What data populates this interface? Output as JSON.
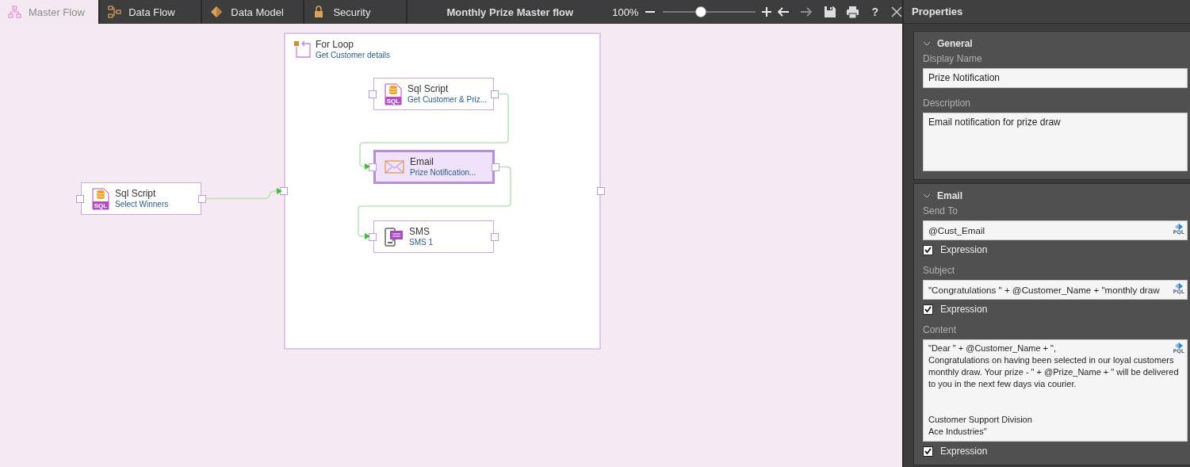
{
  "tabs": [
    {
      "label": "Master Flow",
      "selected": true
    },
    {
      "label": "Data Flow",
      "selected": false
    },
    {
      "label": "Data Model",
      "selected": false
    },
    {
      "label": "Security",
      "selected": false
    }
  ],
  "toolbar": {
    "title": "Monthly Prize Master flow",
    "zoom": "100%",
    "zoom_slider": {
      "level": 0.41
    },
    "buttons": [
      {
        "kind": "undo",
        "disabled": false
      },
      {
        "kind": "redo",
        "disabled": true
      },
      {
        "kind": "save",
        "disabled": false
      },
      {
        "kind": "print",
        "disabled": false
      },
      {
        "kind": "help",
        "label": "?",
        "disabled": false
      },
      {
        "kind": "close",
        "disabled": false
      }
    ]
  },
  "canvas": {
    "nodes": [
      {
        "kind": "sql",
        "icon_label": "SQL",
        "title": "Sql Script",
        "subtitle": "Select Winners",
        "selected": false
      },
      {
        "kind": "loop",
        "title": "For Loop",
        "subtitle": "Get Customer details",
        "selected": false,
        "children": [
          {
            "kind": "sql",
            "icon_label": "SQL",
            "title": "Sql Script",
            "subtitle": "Get Customer & Priz...",
            "selected": false
          },
          {
            "kind": "email",
            "title": "Email",
            "subtitle": "Prize Notification...",
            "selected": true
          },
          {
            "kind": "sms",
            "title": "SMS",
            "subtitle": "SMS 1",
            "selected": false
          }
        ]
      }
    ]
  },
  "properties": {
    "title": "Properties",
    "sections": [
      {
        "title": "General",
        "expanded": true,
        "fields": [
          {
            "kind": "text",
            "label": "Display Name",
            "value": "Prize Notification"
          },
          {
            "kind": "multiline",
            "label": "Description",
            "value": "Email notification for prize draw"
          }
        ]
      },
      {
        "title": "Email",
        "expanded": true,
        "fields": [
          {
            "kind": "expression",
            "label": "Send To",
            "value": "@Cust_Email",
            "badge": "PQL",
            "expression": {
              "label": "Expression",
              "checked": true
            }
          },
          {
            "kind": "expression",
            "label": "Subject",
            "value": "\"Congratulations \" + @Customer_Name + \"monthly draw",
            "badge": "PQL",
            "expression": {
              "label": "Expression",
              "checked": true
            }
          },
          {
            "kind": "expression_multiline",
            "label": "Content",
            "value": "\"Dear \" + @Customer_Name + \",\nCongratulations on having been selected in our loyal customers monthly draw. Your prize - \" + @Prize_Name + \" will be delivered to you in the next few days via courier.\n\n\nCustomer Support Division\nAce Industries\"",
            "badge": "PQL",
            "expression": {
              "label": "Expression",
              "checked": true
            }
          }
        ]
      }
    ]
  }
}
